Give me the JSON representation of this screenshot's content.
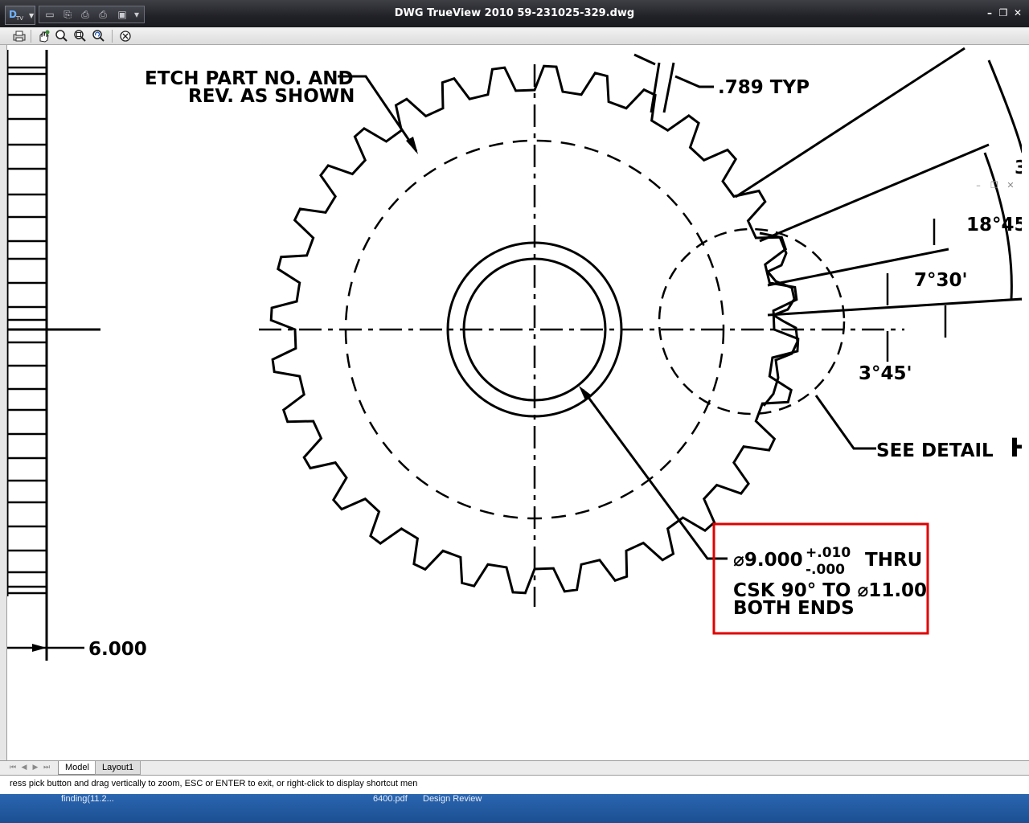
{
  "window": {
    "title": "DWG TrueView 2010    59-231025-329.dwg",
    "app_button_logo": "D",
    "app_button_sub": "TV",
    "controls": {
      "minimize": "–",
      "restore": "❐",
      "close": "✕"
    }
  },
  "quick_access": [
    {
      "name": "open-icon",
      "glyph": "▭"
    },
    {
      "name": "export-icon",
      "glyph": "⎘"
    },
    {
      "name": "print-icon",
      "glyph": "⎙"
    },
    {
      "name": "batch-plot-icon",
      "glyph": "⎙"
    },
    {
      "name": "publish-icon",
      "glyph": "▣"
    },
    {
      "name": "dropdown-icon",
      "glyph": "▾"
    }
  ],
  "toolbar": [
    {
      "name": "plot-icon"
    },
    {
      "name": "pan-icon"
    },
    {
      "name": "zoom-realtime-icon"
    },
    {
      "name": "zoom-window-icon"
    },
    {
      "name": "zoom-previous-icon"
    },
    {
      "name": "close-drawing-icon"
    }
  ],
  "drawing": {
    "note_etch_line1": "ETCH PART NO. AND",
    "note_etch_line2": "REV. AS SHOWN",
    "dim_789": ".789  TYP",
    "angle_1845": "18°45'",
    "angle_730": "7°30'",
    "angle_345": "3°45'",
    "see_detail": "SEE DETAIL",
    "partial_3": "3",
    "partial_h": "H",
    "dim_6000": "6.000",
    "hole_callout": {
      "dia": "⌀9.000",
      "tol_plus": "+.010",
      "tol_minus": "-.000",
      "thru": "THRU",
      "csk": "CSK  90°  TO  ⌀11.00",
      "both_ends": "BOTH ENDS"
    },
    "highlight_color": "#e00000"
  },
  "viewport_controls": {
    "minimize": "–",
    "restore": "❐",
    "close": "✕"
  },
  "layout_tabs": {
    "nav": [
      "⏮",
      "◀",
      "▶",
      "⏭"
    ],
    "model": "Model",
    "layout1": "Layout1"
  },
  "command_line": "ress pick button and drag vertically to zoom, ESC or ENTER to exit, or right-click to display shortcut men",
  "taskbar": [
    "finding(11.2...",
    "6400.pdf",
    "Design Review"
  ]
}
